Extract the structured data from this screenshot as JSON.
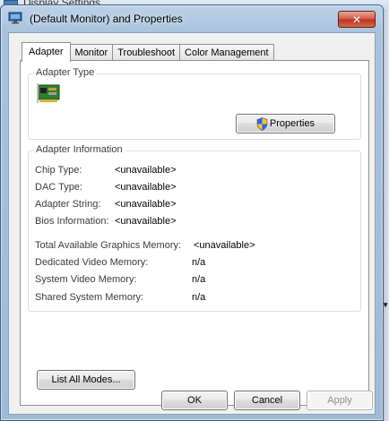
{
  "background_window": {
    "title": "Display Settings"
  },
  "dialog": {
    "title": "(Default Monitor) and  Properties",
    "close_glyph": "✕"
  },
  "tabs": [
    {
      "label": "Adapter",
      "active": true
    },
    {
      "label": "Monitor",
      "active": false
    },
    {
      "label": "Troubleshoot",
      "active": false
    },
    {
      "label": "Color Management",
      "active": false
    }
  ],
  "adapter_type": {
    "legend": "Adapter Type",
    "properties_button": "Properties"
  },
  "adapter_info": {
    "legend": "Adapter Information",
    "rows": [
      {
        "label": "Chip Type:",
        "value": "<unavailable>"
      },
      {
        "label": "DAC Type:",
        "value": "<unavailable>"
      },
      {
        "label": "Adapter String:",
        "value": "<unavailable>"
      },
      {
        "label": "Bios Information:",
        "value": "<unavailable>"
      }
    ],
    "memory": [
      {
        "label": "Total Available Graphics Memory:",
        "value": "<unavailable>"
      },
      {
        "label": "Dedicated Video Memory:",
        "value": "n/a"
      },
      {
        "label": "System Video Memory:",
        "value": "n/a"
      },
      {
        "label": "Shared System Memory:",
        "value": "n/a"
      }
    ]
  },
  "list_modes_button": "List All Modes...",
  "footer": {
    "ok": "OK",
    "cancel": "Cancel",
    "apply": "Apply"
  },
  "colors": {
    "close_button": "#c0361d",
    "frame": "#a9c3dd"
  }
}
